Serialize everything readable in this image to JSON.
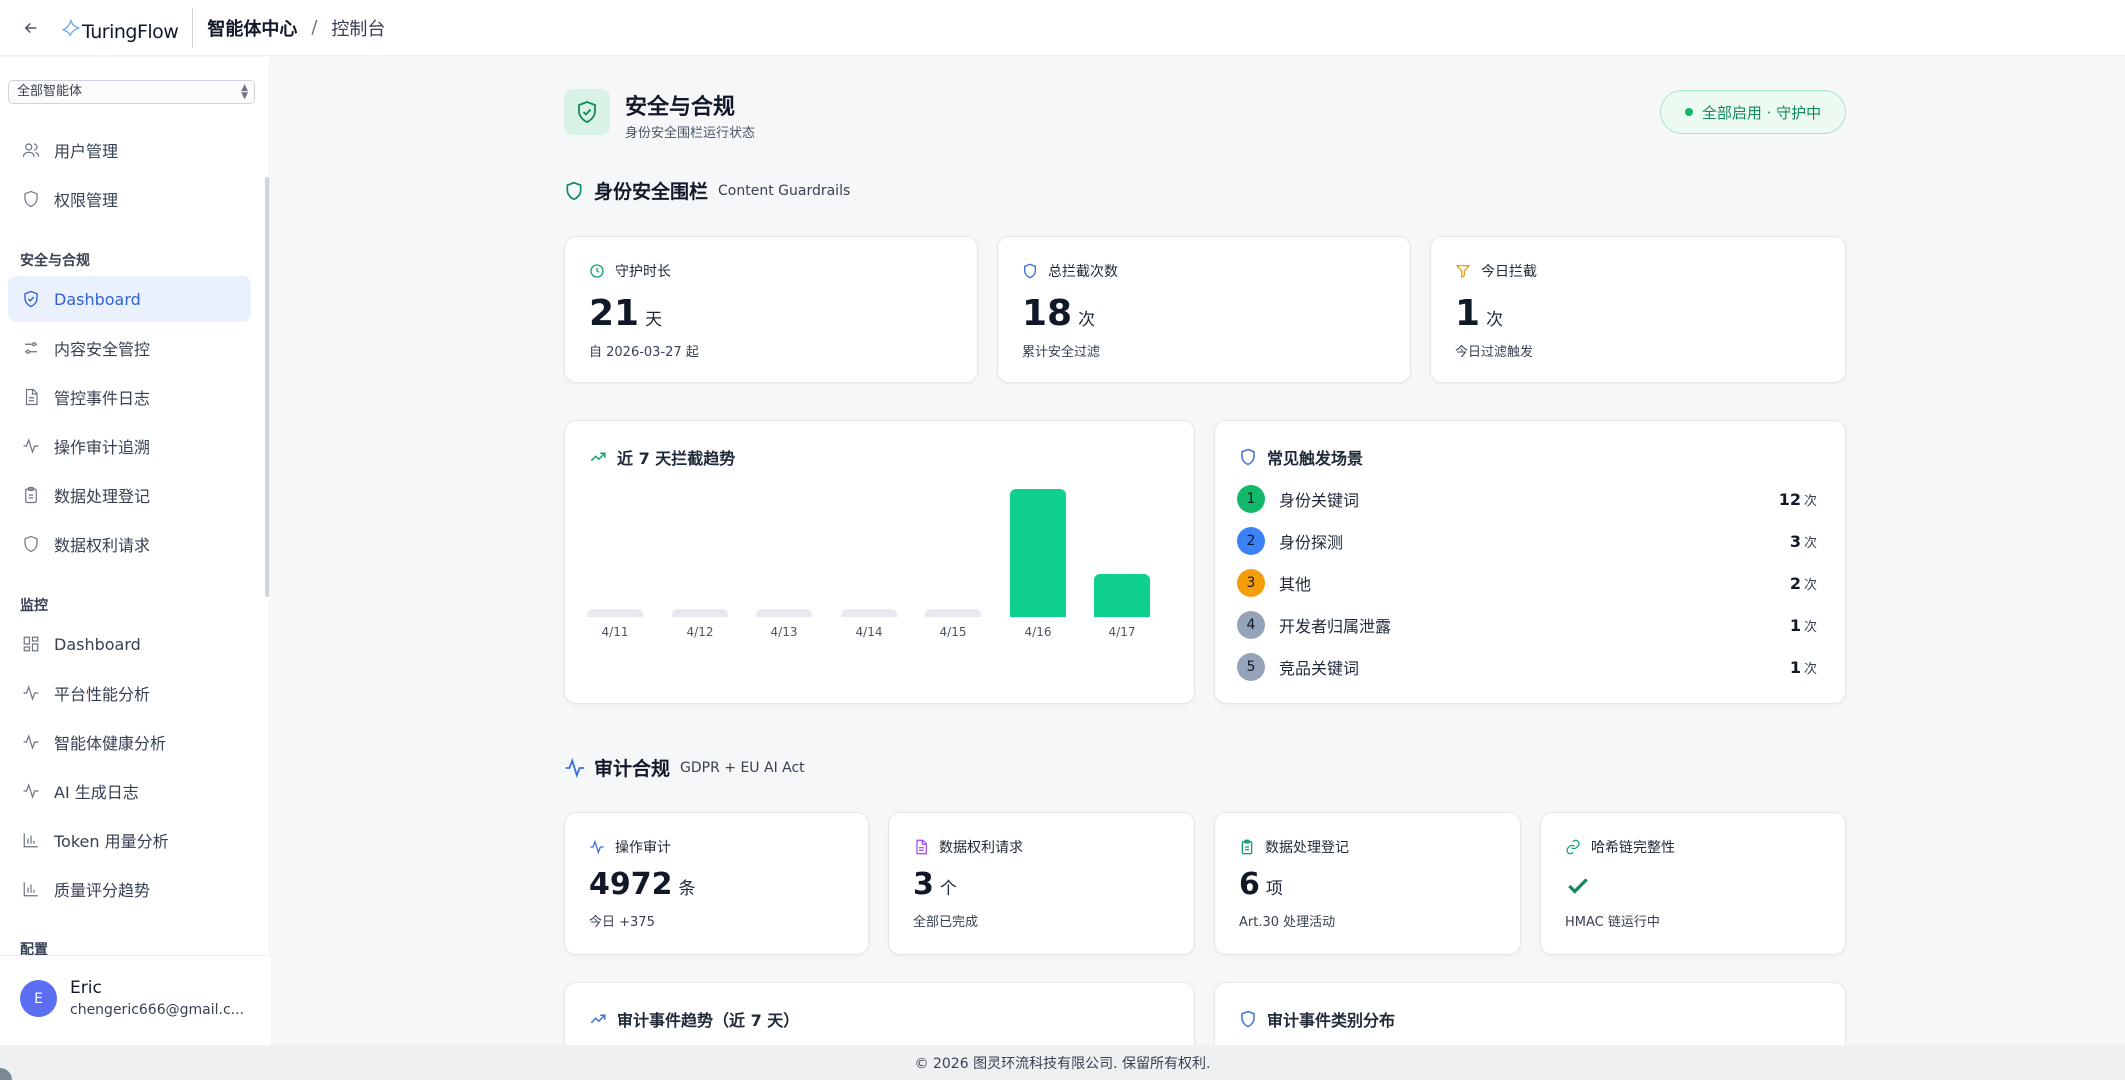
{
  "header": {
    "logo_text": "TuringFlow",
    "breadcrumb_primary": "智能体中心",
    "breadcrumb_sep": "/",
    "breadcrumb_secondary": "控制台"
  },
  "sidebar": {
    "agent_select": "全部智能体",
    "items_top": [
      {
        "label": "用户管理",
        "icon": "users-icon"
      },
      {
        "label": "权限管理",
        "icon": "shield-icon"
      }
    ],
    "section_security": "安全与合规",
    "items_security": [
      {
        "label": "Dashboard",
        "icon": "shield-check-icon",
        "active": true
      },
      {
        "label": "内容安全管控",
        "icon": "sliders-icon"
      },
      {
        "label": "管控事件日志",
        "icon": "file-icon"
      },
      {
        "label": "操作审计追溯",
        "icon": "activity-icon"
      },
      {
        "label": "数据处理登记",
        "icon": "clipboard-icon"
      },
      {
        "label": "数据权利请求",
        "icon": "shield-icon"
      }
    ],
    "section_monitor": "监控",
    "items_monitor": [
      {
        "label": "Dashboard",
        "icon": "grid-icon"
      },
      {
        "label": "平台性能分析",
        "icon": "activity-icon"
      },
      {
        "label": "智能体健康分析",
        "icon": "activity-icon"
      },
      {
        "label": "AI 生成日志",
        "icon": "activity-icon"
      },
      {
        "label": "Token 用量分析",
        "icon": "bar-chart-icon"
      },
      {
        "label": "质量评分趋势",
        "icon": "bar-chart-icon"
      }
    ],
    "section_config": "配置",
    "user": {
      "initial": "E",
      "name": "Eric",
      "email": "chengeric666@gmail.c..."
    }
  },
  "page": {
    "title": "安全与合规",
    "subtitle": "身份安全围栏运行状态",
    "status": "全部启用 · 守护中"
  },
  "guardrails": {
    "title": "身份安全围栏",
    "title_en": "Content Guardrails",
    "stats": [
      {
        "label": "守护时长",
        "value": "21",
        "unit": "天",
        "foot": "自 2026-03-27 起",
        "icon": "clock-icon",
        "color": "#12a36b"
      },
      {
        "label": "总拦截次数",
        "value": "18",
        "unit": "次",
        "foot": "累计安全过滤",
        "icon": "shield-icon",
        "color": "#3b6fd8"
      },
      {
        "label": "今日拦截",
        "value": "1",
        "unit": "次",
        "foot": "今日过滤触发",
        "icon": "filter-icon",
        "color": "#e8a317"
      }
    ],
    "trend_title": "近 7 天拦截趋势",
    "scenes_title": "常见触发场景",
    "scenes": [
      {
        "rank": "1",
        "name": "身份关键词",
        "count": "12",
        "unit": "次",
        "color": "#12b76a"
      },
      {
        "rank": "2",
        "name": "身份探测",
        "count": "3",
        "unit": "次",
        "color": "#3b82f6"
      },
      {
        "rank": "3",
        "name": "其他",
        "count": "2",
        "unit": "次",
        "color": "#f59e0b"
      },
      {
        "rank": "4",
        "name": "开发者归属泄露",
        "count": "1",
        "unit": "次",
        "color": "#94a3b8"
      },
      {
        "rank": "5",
        "name": "竞品关键词",
        "count": "1",
        "unit": "次",
        "color": "#94a3b8"
      }
    ]
  },
  "chart_data": {
    "type": "bar",
    "categories": [
      "4/11",
      "4/12",
      "4/13",
      "4/14",
      "4/15",
      "4/16",
      "4/17"
    ],
    "values": [
      0,
      0,
      0,
      0,
      0,
      12,
      4
    ],
    "colors": {
      "active": "#10d08e",
      "empty": "#e6e9ef"
    },
    "grid": false
  },
  "audit": {
    "title": "审计合规",
    "title_en": "GDPR + EU AI Act",
    "stats": [
      {
        "label": "操作审计",
        "value": "4972",
        "unit": "条",
        "foot": "今日 +375",
        "icon": "activity-icon",
        "color": "#3b6fd8"
      },
      {
        "label": "数据权利请求",
        "value": "3",
        "unit": "个",
        "foot": "全部已完成",
        "icon": "file-icon",
        "color": "#a855f7"
      },
      {
        "label": "数据处理登记",
        "value": "6",
        "unit": "项",
        "foot": "Art.30 处理活动",
        "icon": "clipboard-icon",
        "color": "#12a36b"
      },
      {
        "label": "哈希链完整性",
        "value": "",
        "unit": "",
        "foot": "HMAC 链运行中",
        "icon": "link-icon",
        "color": "#12a36b"
      }
    ],
    "events_trend_title": "审计事件趋势（近 7 天）",
    "events_dist_title": "审计事件类别分布"
  },
  "footer": "© 2026 图灵环流科技有限公司. 保留所有权利."
}
